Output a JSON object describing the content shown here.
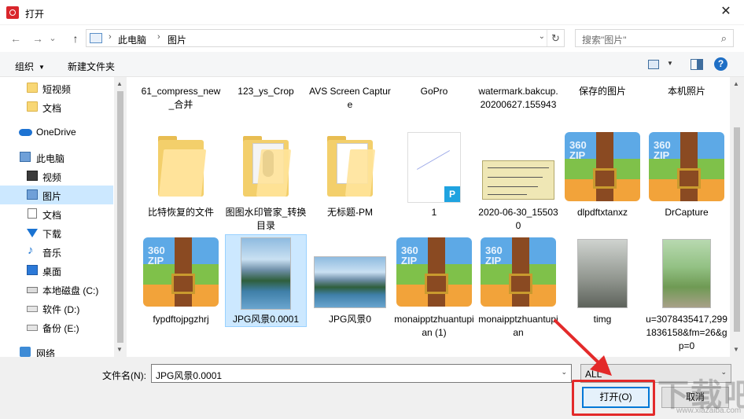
{
  "window": {
    "title": "打开",
    "close_glyph": "✕"
  },
  "nav": {
    "back": "←",
    "forward": "→",
    "dropdown": "⌄",
    "up": "↑"
  },
  "address": {
    "sep1": "›",
    "crumb1": "此电脑",
    "sep2": "›",
    "crumb2": "图片",
    "dropdown": "⌄",
    "refresh": "↻"
  },
  "search": {
    "placeholder": "搜索\"图片\"",
    "icon": "⌕"
  },
  "toolbar": {
    "organize": "组织",
    "new_folder": "新建文件夹",
    "help": "?"
  },
  "sidebar": {
    "items": [
      {
        "label": "短视频",
        "icon": "folder"
      },
      {
        "label": "文档",
        "icon": "folder"
      },
      {
        "label": "OneDrive",
        "icon": "cloud"
      },
      {
        "label": "此电脑",
        "icon": "pc"
      },
      {
        "label": "视频",
        "icon": "video"
      },
      {
        "label": "图片",
        "icon": "picture"
      },
      {
        "label": "文档",
        "icon": "document"
      },
      {
        "label": "下载",
        "icon": "download"
      },
      {
        "label": "音乐",
        "icon": "music"
      },
      {
        "label": "桌面",
        "icon": "desktop"
      },
      {
        "label": "本地磁盘 (C:)",
        "icon": "drive"
      },
      {
        "label": "软件 (D:)",
        "icon": "drive"
      },
      {
        "label": "备份 (E:)",
        "icon": "drive"
      },
      {
        "label": "网络",
        "icon": "network"
      }
    ],
    "selected": "图片"
  },
  "files": {
    "row1": [
      "61_compress_new_合并",
      "123_ys_Crop",
      "AVS Screen Capture",
      "GoPro",
      "watermark.bakcup.20200627.155943",
      "保存的图片",
      "本机照片"
    ],
    "row2": [
      "比特恢复的文件",
      "图图水印管家_转换目录",
      "无标题-PM",
      "1",
      "2020-06-30_155030",
      "dlpdftxtanxz",
      "DrCapture"
    ],
    "row3": [
      "fypdftojpgzhrj",
      "JPG风景0.0001",
      "JPG风景0",
      "monaipptzhuantupian (1)",
      "monaipptzhuantupian",
      "timg",
      "u=3078435417,2991836158&fm=26&gp=0"
    ],
    "zip_tag": "360\nZIP",
    "pdf_badge": "P",
    "selected": "JPG风景0.0001"
  },
  "bottom": {
    "filename_label": "文件名(N):",
    "filename_value": "JPG风景0.0001",
    "filter_value": "ALL",
    "open_label": "打开(O)",
    "cancel_label": "取消",
    "dropdown": "⌄"
  },
  "scroll": {
    "up": "▲",
    "down": "▼"
  },
  "watermark": {
    "main": "下载吧",
    "sub": "www.xiazaiba.com"
  },
  "colors": {
    "accent": "#0078d7",
    "selection": "#cce8ff",
    "annotation": "#e32a2a"
  }
}
